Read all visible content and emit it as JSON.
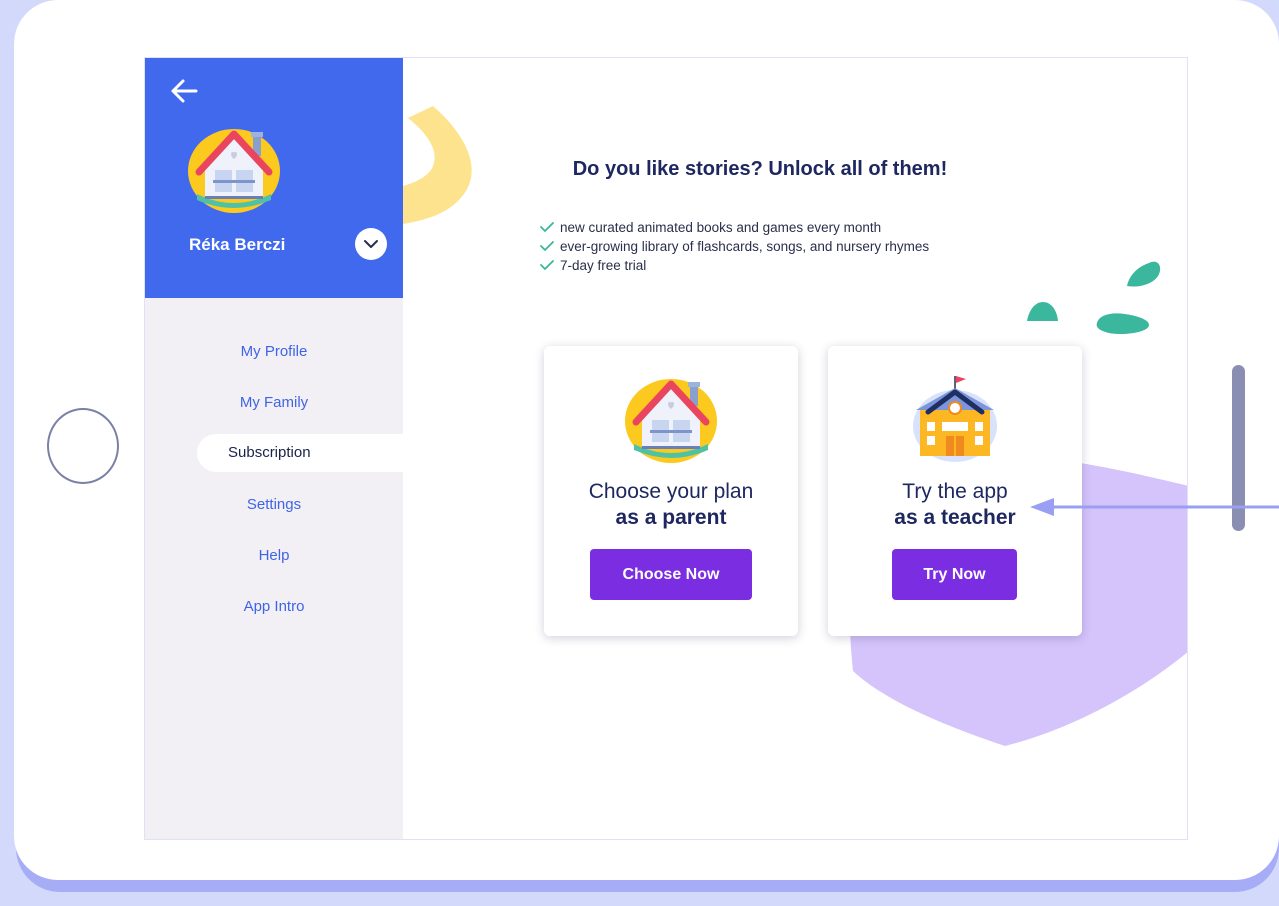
{
  "user": {
    "name": "Réka Berczi"
  },
  "sidebar": {
    "items": [
      {
        "label": "My Profile",
        "active": false
      },
      {
        "label": "My Family",
        "active": false
      },
      {
        "label": "Subscription",
        "active": true
      },
      {
        "label": "Settings",
        "active": false
      },
      {
        "label": "Help",
        "active": false
      },
      {
        "label": "App Intro",
        "active": false
      }
    ]
  },
  "main": {
    "headline": "Do you like stories? Unlock all of them!",
    "features": [
      "new curated animated books and games every month",
      "ever-growing library of flashcards, songs, and nursery rhymes",
      "7-day free trial"
    ],
    "cards": [
      {
        "line1": "Choose your plan",
        "line2": "as a parent",
        "button": "Choose Now",
        "icon": "house-icon"
      },
      {
        "line1": "Try the app",
        "line2": "as a teacher",
        "button": "Try Now",
        "icon": "school-icon"
      }
    ]
  },
  "colors": {
    "sidebar_header": "#4169ee",
    "accent_button": "#7b2de2",
    "nav_text": "#3f64e6",
    "headline": "#1e2760",
    "background": "#d2d9fb",
    "deco_teal": "#3bb79d",
    "deco_yellow": "#fee38e",
    "deco_purple": "#d5c3fb"
  }
}
